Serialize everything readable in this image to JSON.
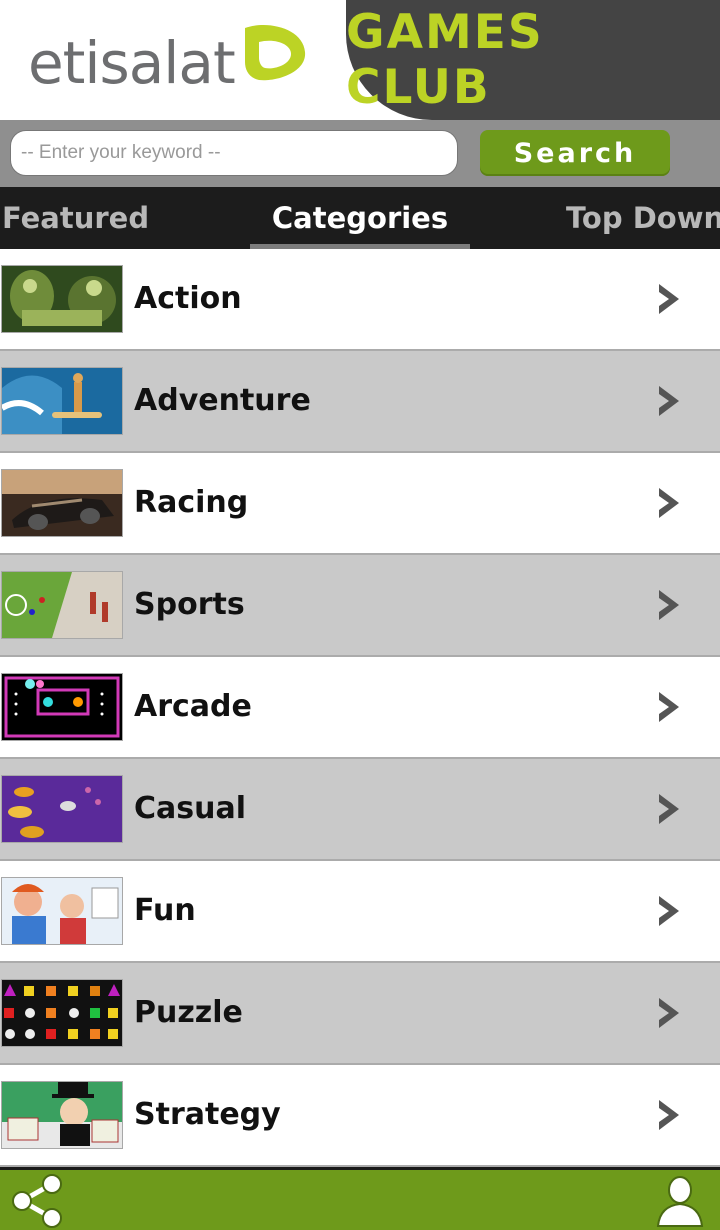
{
  "header": {
    "brand": "etisalat",
    "title": "GAMES CLUB",
    "colors": {
      "brand_green": "#bcd325",
      "dark_tab": "#444444"
    }
  },
  "search": {
    "placeholder": "-- Enter your keyword --",
    "value": "",
    "button_label": "Search"
  },
  "tabs": [
    {
      "label": "Featured",
      "selected": false
    },
    {
      "label": "Categories",
      "selected": true
    },
    {
      "label": "Top Download",
      "selected": false
    }
  ],
  "categories": [
    {
      "label": "Action",
      "icon": "chevron-right-icon"
    },
    {
      "label": "Adventure",
      "icon": "chevron-right-icon"
    },
    {
      "label": "Racing",
      "icon": "chevron-right-icon"
    },
    {
      "label": "Sports",
      "icon": "chevron-right-icon"
    },
    {
      "label": "Arcade",
      "icon": "chevron-right-icon"
    },
    {
      "label": "Casual",
      "icon": "chevron-right-icon"
    },
    {
      "label": "Fun",
      "icon": "chevron-right-icon"
    },
    {
      "label": "Puzzle",
      "icon": "chevron-right-icon"
    },
    {
      "label": "Strategy",
      "icon": "chevron-right-icon"
    }
  ],
  "bottom_bar": {
    "left_icon": "share-icon",
    "right_icon": "profile-icon",
    "color": "#6e9a1b"
  }
}
